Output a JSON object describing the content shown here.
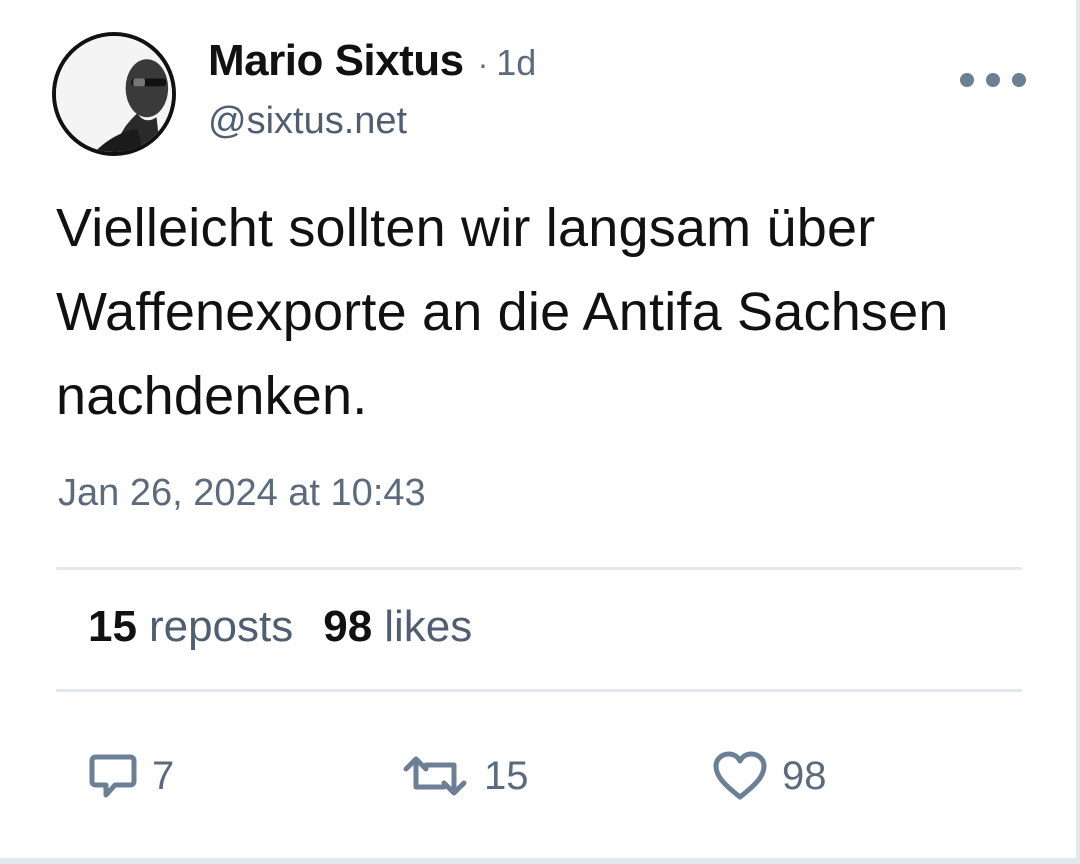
{
  "author": {
    "display_name": "Mario Sixtus",
    "separator": "·",
    "time_ago": "1d",
    "handle": "@sixtus.net",
    "avatar_icon": "avatar-portrait"
  },
  "menu": {
    "more_icon": "more-horizontal-icon"
  },
  "post": {
    "text": "Vielleicht sollten wir langsam über Waffenexporte an die Antifa Sachsen nachdenken.",
    "timestamp": "Jan 26, 2024 at 10:43"
  },
  "stats": {
    "reposts_count": "15",
    "reposts_label": "reposts",
    "likes_count": "98",
    "likes_label": "likes"
  },
  "actions": {
    "reply_icon": "comment-icon",
    "reply_count": "7",
    "repost_icon": "repost-icon",
    "repost_count": "15",
    "like_icon": "heart-icon",
    "like_count": "98"
  },
  "colors": {
    "icon_gray": "#6b7f95",
    "secondary_text": "#5b6b7d",
    "divider": "#e3e8ee"
  }
}
